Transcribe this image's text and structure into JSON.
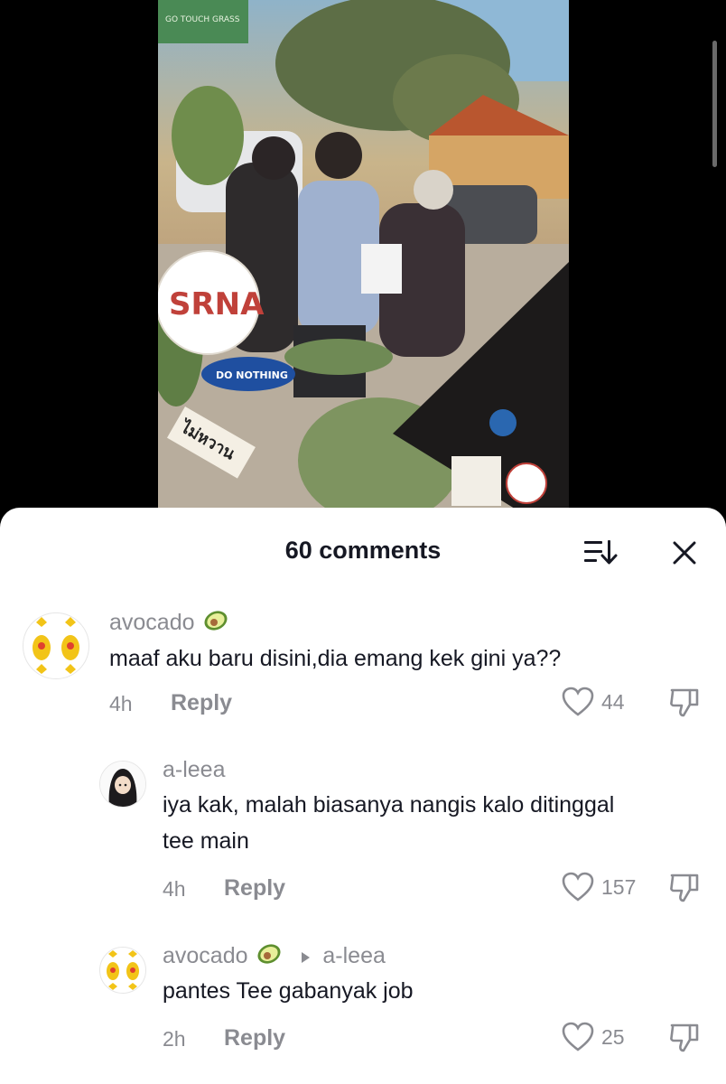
{
  "photo": {
    "sign_top": "GO TOUCH GRASS",
    "sticker_brand": "SRNA",
    "sticker_do_nothing": "DO NOTHING",
    "sticker_thai": "ไม่หวาน"
  },
  "header": {
    "title": "60 comments"
  },
  "comments": [
    {
      "username": "avocado",
      "text": "maaf aku baru disini,dia emang kek gini ya??",
      "time": "4h",
      "reply_label": "Reply",
      "likes": "44"
    },
    {
      "username": "a-leea",
      "text_line1": "iya kak, malah biasanya nangis kalo ditinggal",
      "text_line2": "tee main",
      "time": "4h",
      "reply_label": "Reply",
      "likes": "157"
    },
    {
      "username": "avocado",
      "reply_to": "a-leea",
      "text": "pantes Tee gabanyak job",
      "time": "2h",
      "reply_label": "Reply",
      "likes": "25"
    }
  ],
  "colors": {
    "text_primary": "#161823",
    "text_secondary": "#8a8b91",
    "sheet_bg": "#ffffff"
  }
}
